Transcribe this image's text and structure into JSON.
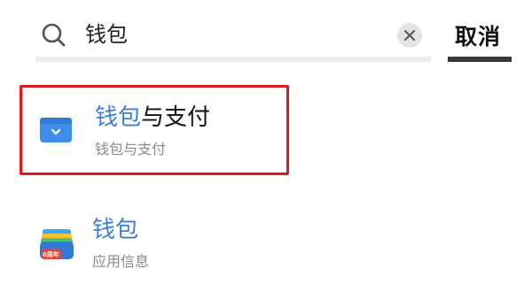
{
  "search": {
    "query": "钱包",
    "cancel_label": "取消"
  },
  "results": [
    {
      "title_highlight": "钱包",
      "title_rest": "与支付",
      "subtitle": "钱包与支付",
      "icon": "wallet-card-icon"
    },
    {
      "title_highlight": "钱包",
      "title_rest": "",
      "subtitle": "应用信息",
      "icon": "wallet-app-icon",
      "icon_badge": "6周年"
    }
  ],
  "colors": {
    "highlight_text": "#3d7fd8",
    "selection_border": "#e0191b",
    "card_icon_blue": "#3b8de8"
  }
}
